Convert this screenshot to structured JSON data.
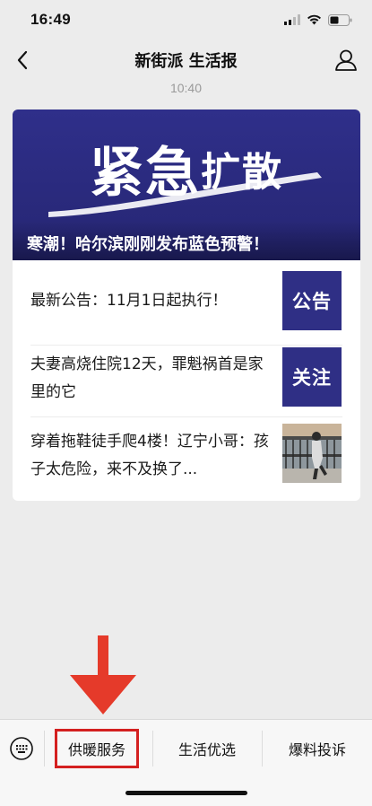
{
  "status_bar": {
    "time": "16:49",
    "icons": [
      "signal-icon",
      "wifi-icon",
      "battery-icon"
    ]
  },
  "nav": {
    "title": "新街派 生活报",
    "back_icon": "chevron-left-icon",
    "profile_icon": "person-icon"
  },
  "chat": {
    "timestamp": "10:40"
  },
  "card": {
    "banner": {
      "heading_big": "紧急",
      "heading_small": "扩散",
      "caption": "寒潮！哈尔滨刚刚发布蓝色预警！"
    },
    "articles": [
      {
        "title": "最新公告：11月1日起执行！",
        "thumb_text": "公告"
      },
      {
        "title": "夫妻高烧住院12天，罪魁祸首是家里的它",
        "thumb_text": "关注"
      },
      {
        "title": "穿着拖鞋徒手爬4楼！辽宁小哥：孩子太危险，来不及换了...",
        "thumb_text": ""
      }
    ]
  },
  "bottom_menu": {
    "keyboard_icon": "keyboard-icon",
    "items": [
      "供暖服务",
      "生活优选",
      "爆料投诉"
    ]
  },
  "colors": {
    "banner_bg": "#2f2f8a",
    "highlight": "#d42020",
    "annotation_arrow": "#e53a2a"
  }
}
